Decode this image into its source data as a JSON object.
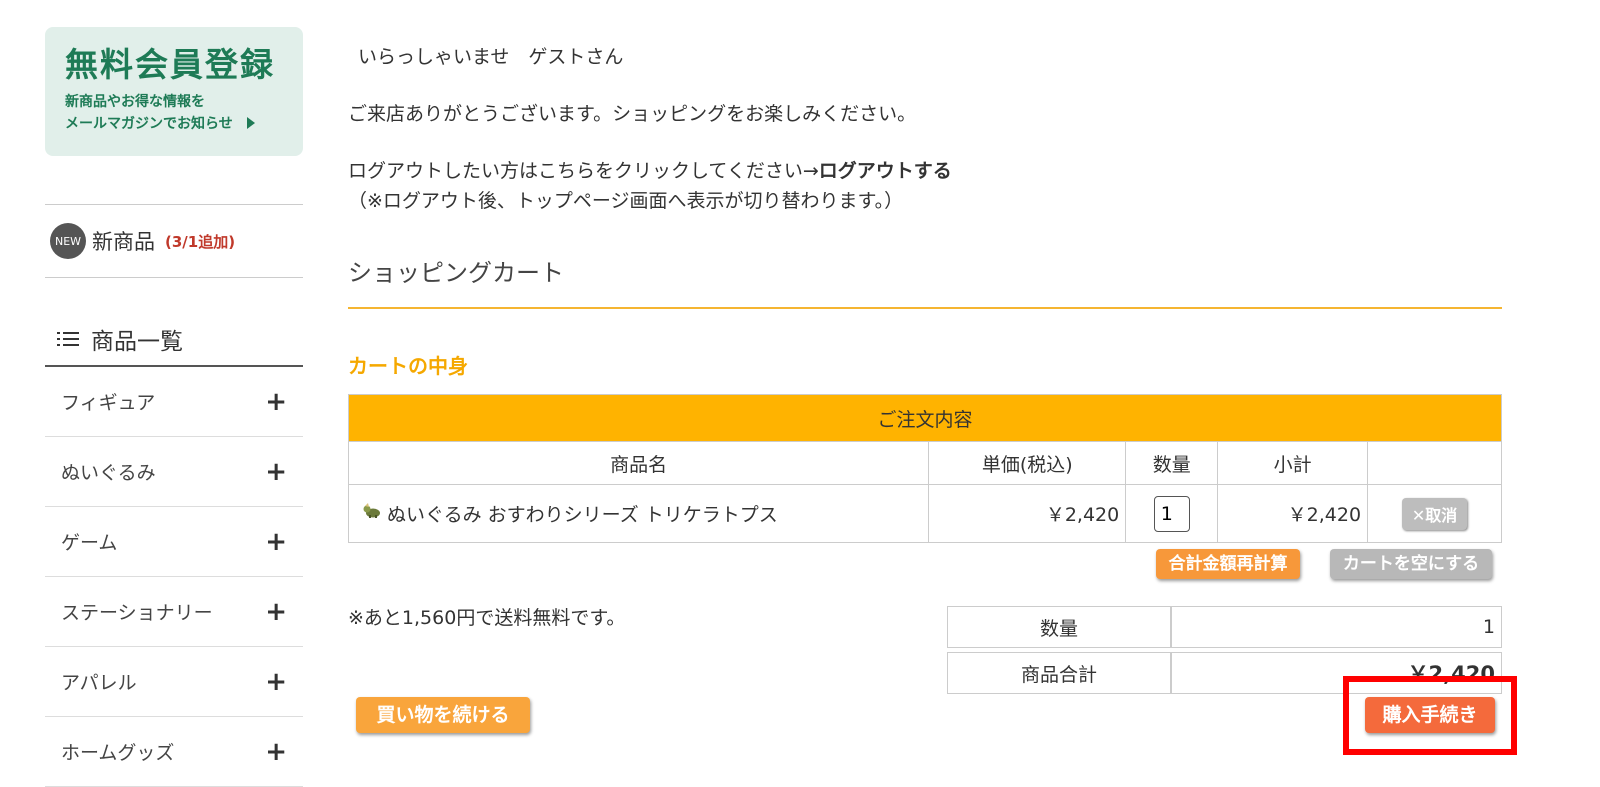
{
  "sidebar": {
    "signup": {
      "title": "無料会員登録",
      "line1": "新商品やお得な情報を",
      "line2": "メールマガジンでお知らせ"
    },
    "new_products": {
      "badge": "NEW",
      "label": "新商品",
      "note": "(3/1追加)"
    },
    "categories_title": "商品一覧",
    "categories": [
      {
        "label": "フィギュア",
        "toggle": "+"
      },
      {
        "label": "ぬいぐるみ",
        "toggle": "+"
      },
      {
        "label": "ゲーム",
        "toggle": "+"
      },
      {
        "label": "ステーショナリー",
        "toggle": "+"
      },
      {
        "label": "アパレル",
        "toggle": "+"
      },
      {
        "label": "ホームグッズ",
        "toggle": "+"
      }
    ]
  },
  "header": {
    "greeting": "いらっしゃいませ　ゲストさん",
    "welcome": "ご来店ありがとうございます。ショッピングをお楽しみください。",
    "logout_prompt": "ログアウトしたい方はこちらをクリックしてください→",
    "logout_link": "ログアウトする",
    "logout_note": "（※ログアウト後、トップページ画面へ表示が切り替わります。）"
  },
  "cart": {
    "title": "ショッピングカート",
    "contents_heading": "カートの中身",
    "order_header": "ご注文内容",
    "columns": [
      "商品名",
      "単価(税込)",
      "数量",
      "小計"
    ],
    "items": [
      {
        "name": "ぬいぐるみ おすわりシリーズ トリケラトプス",
        "price": "￥2,420",
        "qty": "1",
        "subtotal": "￥2,420",
        "cancel": "✕取消"
      }
    ],
    "recalc_button": "合計金額再計算",
    "empty_button": "カートを空にする",
    "shipping_note": "※あと1,560円で送料無料です。",
    "summary": {
      "qty_label": "数量",
      "qty_value": "1",
      "total_label": "商品合計",
      "total_value": "￥2,420"
    },
    "continue_button": "買い物を続ける",
    "checkout_button": "購入手続き"
  },
  "colors": {
    "accent_orange": "#ffb300",
    "signup_green": "#1e7b56",
    "checkout_button": "#f46a3c",
    "highlight_box": "#ff0000"
  }
}
